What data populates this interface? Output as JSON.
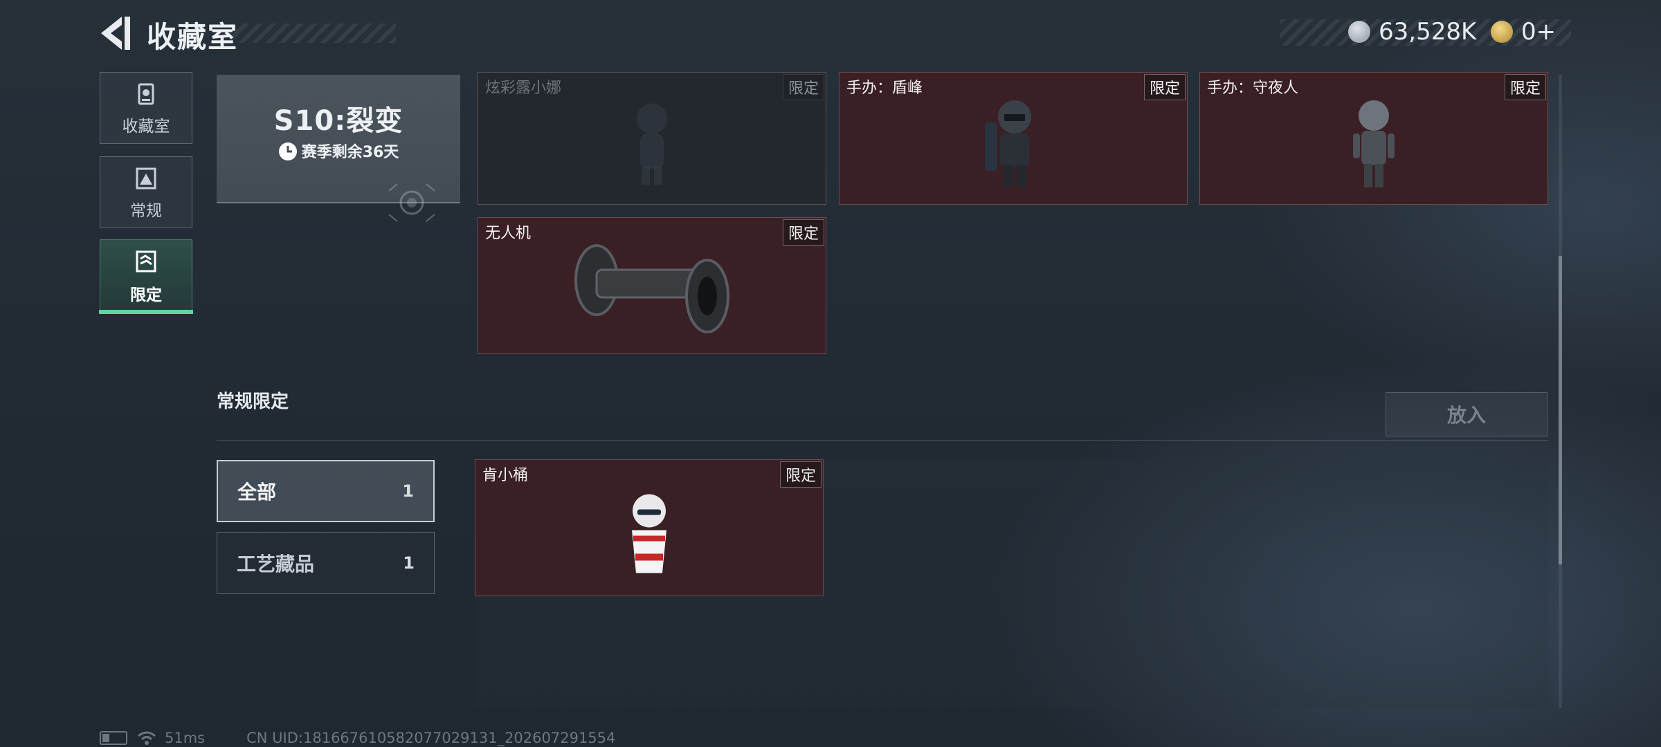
{
  "header": {
    "title": "收藏室",
    "currency_1": "63,528K",
    "currency_2": "0+"
  },
  "nav": [
    {
      "label": "收藏室",
      "icon": "trophy-icon"
    },
    {
      "label": "常规",
      "icon": "mountain-image-icon"
    },
    {
      "label": "限定",
      "icon": "limited-image-icon",
      "selected": true
    }
  ],
  "season": {
    "title": "S10:裂变",
    "remaining": "赛季剩余36天"
  },
  "limited_items": [
    {
      "name": "炫彩露小娜",
      "tag": "限定",
      "locked": true
    },
    {
      "name": "手办：盾峰",
      "tag": "限定"
    },
    {
      "name": "手办：守夜人",
      "tag": "限定"
    },
    {
      "name": "无人机",
      "tag": "限定"
    }
  ],
  "section": {
    "title": "常规限定",
    "put_in": "放入"
  },
  "filters": [
    {
      "label": "全部",
      "count": "1",
      "selected": true
    },
    {
      "label": "工艺藏品",
      "count": "1"
    }
  ],
  "regular_items": [
    {
      "name": "肯小桶",
      "tag": "限定"
    }
  ],
  "footer": {
    "ping": "51ms",
    "uid": "CN UID:181667610582077029131_202607291554"
  },
  "colors": {
    "accent": "#5bd6a0",
    "card_bg": "#3a1f25",
    "background": "#222b34"
  }
}
